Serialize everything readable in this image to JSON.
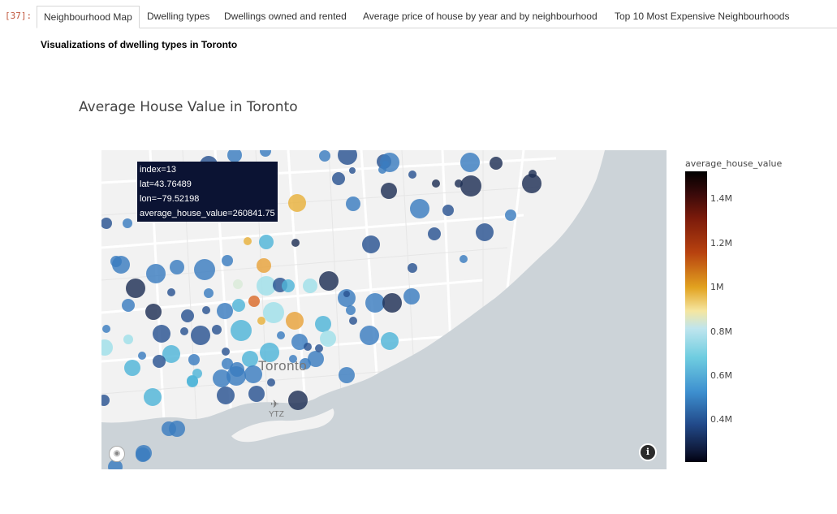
{
  "cell": {
    "prompt": "[37]:"
  },
  "tabs": [
    {
      "label": "Neighbourhood Map",
      "active": true
    },
    {
      "label": "Dwelling types",
      "active": false
    },
    {
      "label": "Dwellings owned and rented",
      "active": false
    },
    {
      "label": "Average price of house by year and by neighbourhood",
      "active": false
    },
    {
      "label": "Top 10 Most Expensive Neighbourhoods",
      "active": false
    }
  ],
  "subtitle": "Visualizations of dwelling types in Toronto",
  "plot": {
    "title": "Average House Value in Toronto",
    "city_label": "Toronto",
    "airport_label": "YTZ",
    "airport_glyph": "✈",
    "info_glyph": "i",
    "logo_glyph": "◉"
  },
  "tooltip": {
    "index": "index=13",
    "lat": "lat=43.76489",
    "lon": "lon=−79.52198",
    "value": "average_house_value=260841.75"
  },
  "colorbar": {
    "title": "average_house_value",
    "ticks": [
      "1.4M",
      "1.2M",
      "1M",
      "0.8M",
      "0.6M",
      "0.4M"
    ]
  },
  "colors": {
    "water": "#ccd3d8",
    "land": "#f2f2f2",
    "tooltip_bg": "#0b1333",
    "prompt": "#c0553b"
  }
}
